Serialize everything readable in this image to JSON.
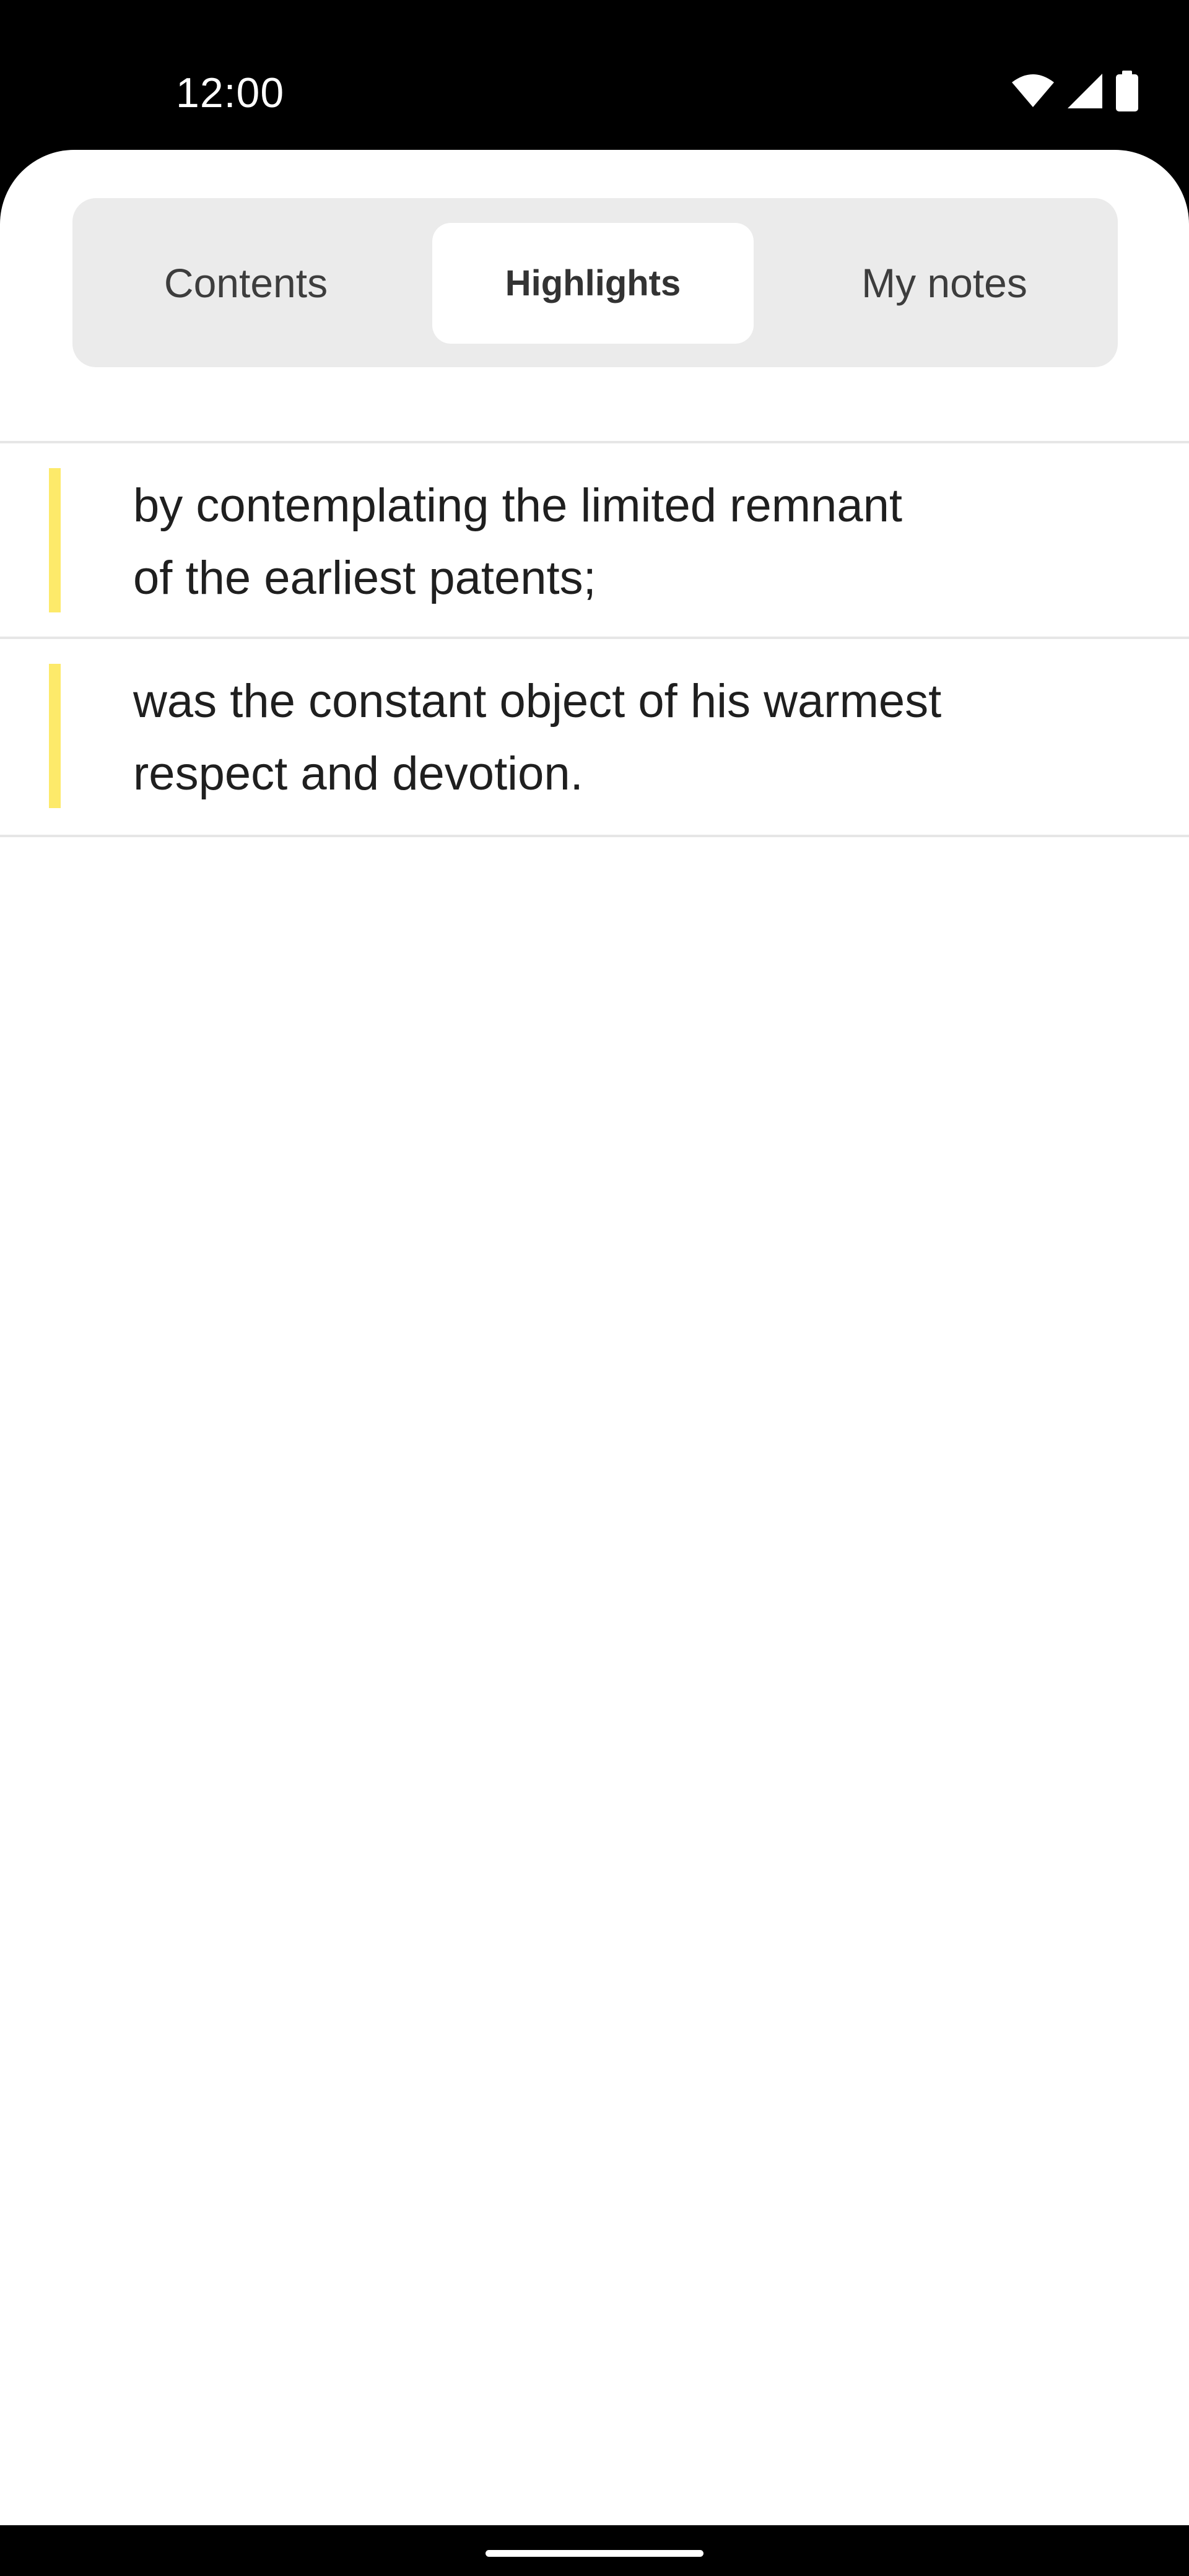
{
  "status_bar": {
    "time": "12:00",
    "icons": [
      "wifi-icon",
      "cellular-signal-icon",
      "battery-icon"
    ]
  },
  "tabs": {
    "contents_label": "Contents",
    "highlights_label": "Highlights",
    "notes_label": "My notes",
    "selected": "Highlights"
  },
  "highlights": [
    {
      "text": "by contemplating the limited remnant\nof the earliest patents;",
      "color": "#fdea6a"
    },
    {
      "text": "was the constant object of his warmest\nrespect and devotion.",
      "color": "#fdea6a"
    }
  ],
  "colors": {
    "highlight": "#fdea6a",
    "segment_background": "#ebebeb",
    "selected_segment": "#ffffff"
  }
}
